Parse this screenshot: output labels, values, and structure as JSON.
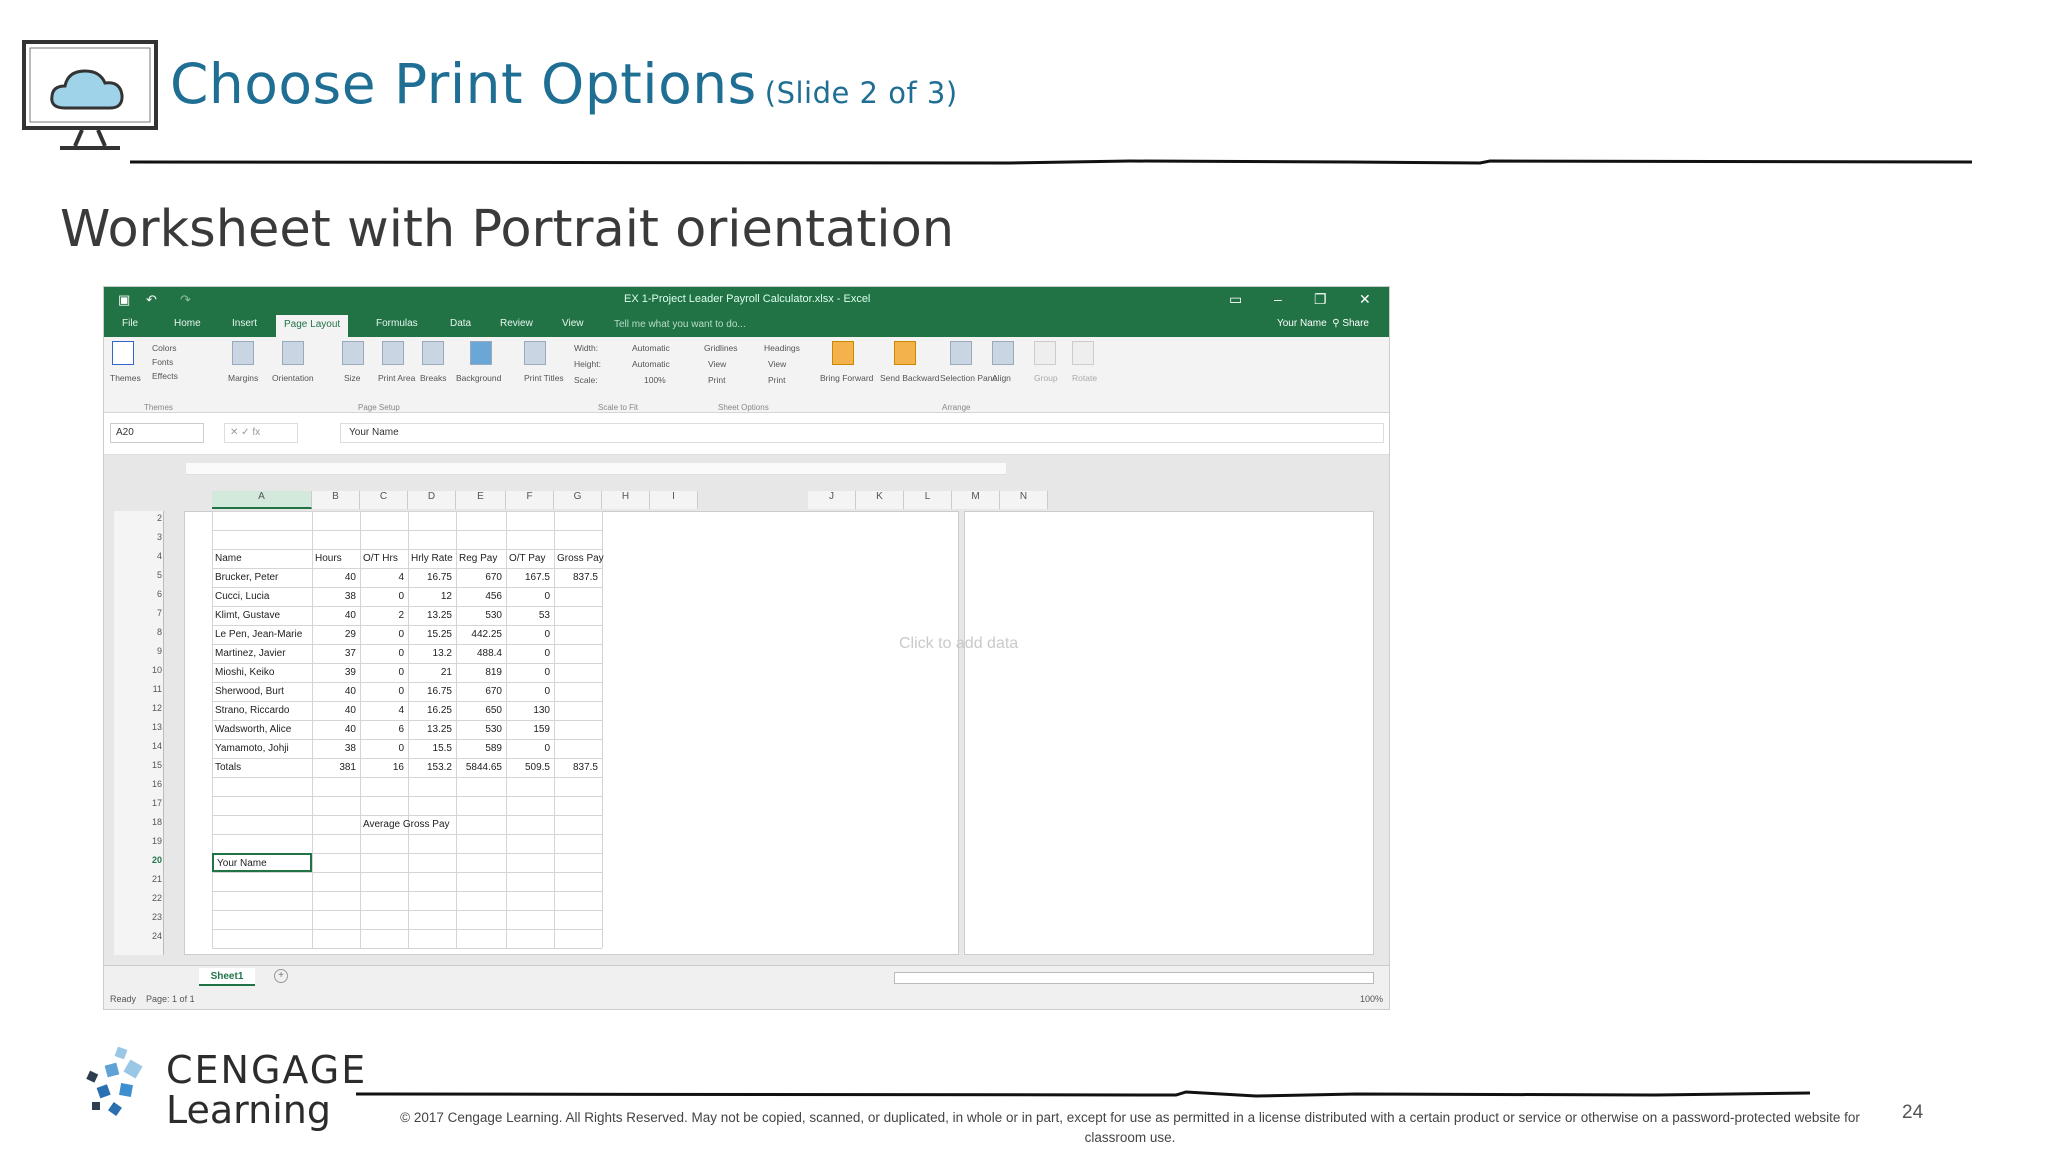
{
  "slide": {
    "title": "Choose Print Options",
    "title_suffix": "(Slide 2 of 3)",
    "subtitle": "Worksheet with Portrait orientation",
    "page_number": "24",
    "copyright": "© 2017 Cengage Learning. All Rights Reserved. May not be copied, scanned, or duplicated, in whole or in part, except for use as permitted in a license distributed with a certain product or service or otherwise on a password-protected website for classroom use.",
    "logo_line1": "CENGAGE",
    "logo_line2": "Learning",
    "title_icon": "cloud-monitor-icon"
  },
  "excel": {
    "window_title": "EX 1-Project Leader Payroll Calculator.xlsx - Excel",
    "user_name": "Your Name",
    "share_label": "Share",
    "tell_me": "Tell me what you want to do...",
    "tabs": [
      "File",
      "Home",
      "Insert",
      "Page Layout",
      "Formulas",
      "Data",
      "Review",
      "View"
    ],
    "active_tab": "Page Layout",
    "ribbon": {
      "themes": [
        "Themes",
        "Colors",
        "Fonts",
        "Effects"
      ],
      "page_setup": [
        "Margins",
        "Orientation",
        "Size",
        "Print Area",
        "Breaks",
        "Background",
        "Print Titles"
      ],
      "scale": [
        "Width:",
        "Automatic",
        "Height:",
        "Automatic",
        "Scale:",
        "100%"
      ],
      "sheet_options": [
        "Gridlines",
        "Headings",
        "View",
        "View",
        "Print",
        "Print"
      ],
      "arrange": [
        "Bring Forward",
        "Send Backward",
        "Selection Pane",
        "Align",
        "Group",
        "Rotate"
      ],
      "group_labels": [
        "Themes",
        "Page Setup",
        "Scale to Fit",
        "Sheet Options",
        "Arrange"
      ]
    },
    "name_box": "A20",
    "formula": "Your Name",
    "columns": [
      "A",
      "B",
      "C",
      "D",
      "E",
      "F",
      "G",
      "H",
      "I",
      "J",
      "K",
      "L",
      "M",
      "N"
    ],
    "row_numbers": [
      "2",
      "3",
      "4",
      "5",
      "6",
      "7",
      "8",
      "9",
      "10",
      "11",
      "12",
      "13",
      "14",
      "15",
      "16",
      "17",
      "18",
      "19",
      "20",
      "21",
      "22",
      "23",
      "24"
    ],
    "headers": [
      "Name",
      "Hours",
      "O/T Hrs",
      "Hrly Rate",
      "Reg Pay",
      "O/T Pay",
      "Gross Pay"
    ],
    "rows": [
      [
        "Brucker, Peter",
        "40",
        "4",
        "16.75",
        "670",
        "167.5",
        "837.5"
      ],
      [
        "Cucci, Lucia",
        "38",
        "0",
        "12",
        "456",
        "0",
        ""
      ],
      [
        "Klimt, Gustave",
        "40",
        "2",
        "13.25",
        "530",
        "53",
        ""
      ],
      [
        "Le Pen, Jean-Marie",
        "29",
        "0",
        "15.25",
        "442.25",
        "0",
        ""
      ],
      [
        "Martinez, Javier",
        "37",
        "0",
        "13.2",
        "488.4",
        "0",
        ""
      ],
      [
        "Mioshi, Keiko",
        "39",
        "0",
        "21",
        "819",
        "0",
        ""
      ],
      [
        "Sherwood, Burt",
        "40",
        "0",
        "16.75",
        "670",
        "0",
        ""
      ],
      [
        "Strano, Riccardo",
        "40",
        "4",
        "16.25",
        "650",
        "130",
        ""
      ],
      [
        "Wadsworth, Alice",
        "40",
        "6",
        "13.25",
        "530",
        "159",
        ""
      ],
      [
        "Yamamoto, Johji",
        "38",
        "0",
        "15.5",
        "589",
        "0",
        ""
      ],
      [
        "Totals",
        "381",
        "16",
        "153.2",
        "5844.65",
        "509.5",
        "837.5"
      ]
    ],
    "avg_label": "Average Gross Pay",
    "your_name_cell": "Your Name",
    "click_to_add": "Click to add data",
    "sheet_tab": "Sheet1",
    "status_ready": "Ready",
    "status_page": "Page: 1 of 1",
    "zoom": "100%"
  }
}
